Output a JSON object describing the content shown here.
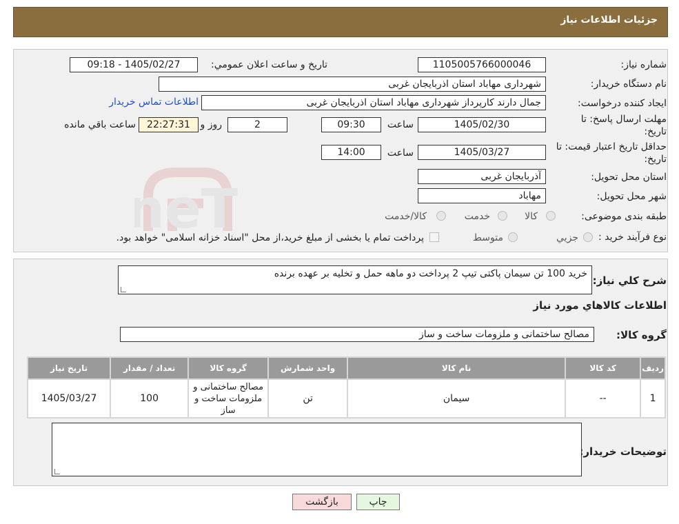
{
  "header": {
    "title": "جزئیات اطلاعات نیاز"
  },
  "form": {
    "need_number_label": "شماره نیاز:",
    "need_number": "1105005766000046",
    "announce_label": "تاريخ و ساعت اعلان عمومي:",
    "announce_value": "1405/02/27 - 09:18",
    "buyer_org_label": "نام دستگاه خريدار:",
    "buyer_org": "شهرداری مهاباد استان اذربایجان غربی",
    "creator_label": "ايجاد کننده درخواست:",
    "creator": "جمال دارند کارپرداز  شهرداری مهاباد استان اذربایجان غربی",
    "contact_link": "اطلاعات تماس خريدار",
    "deadline_label_1": "مهلت ارسال پاسخ: تا",
    "deadline_label_2": "تاريخ:",
    "deadline_date": "1405/02/30",
    "time_label": "ساعت",
    "deadline_time": "09:30",
    "days_value": "2",
    "days_label": "روز و",
    "remaining_time": "22:27:31",
    "remaining_label": "ساعت باقي مانده",
    "price_label_1": "حداقل تاريخ اعتبار قيمت: تا",
    "price_label_2": "تاريخ:",
    "price_date": "1405/03/27",
    "price_time": "14:00",
    "province_label": "استان محل تحويل:",
    "province": "آذربایجان غربی",
    "city_label": "شهر محل تحويل:",
    "city": "مهاباد",
    "category_label": "طبقه بندی موضوعی:",
    "category_options": [
      "کالا",
      "خدمت",
      "کالا/خدمت"
    ],
    "process_label": "نوع فرآيند خريد :",
    "process_options": [
      "جزيي",
      "متوسط"
    ],
    "process_note": "پرداخت تمام يا بخشی از مبلغ خريد،از محل \"اسناد خزانه اسلامی\" خواهد بود."
  },
  "summary": {
    "label": "شرح کلي نياز:",
    "text": "خرید 100 تن سیمان پاکتی تیپ 2 پرداخت دو ماهه حمل و تخلیه بر عهده برنده",
    "items_heading": "اطلاعات کالاهاي مورد نياز",
    "group_label": "گروه کالا:",
    "group_value": "مصالح ساختمانی و ملزومات ساخت و ساز"
  },
  "table": {
    "headers": [
      "رديف",
      "کد کالا",
      "نام کالا",
      "واحد شمارش",
      "گروه کالا",
      "تعداد / مقدار",
      "تاريخ نياز"
    ],
    "rows": [
      [
        "1",
        "--",
        "سیمان",
        "تن",
        "مصالح ساختمانی و ملزومات ساخت و ساز",
        "100",
        "1405/03/27"
      ]
    ]
  },
  "notes": {
    "label": "توضيحات خريدار:",
    "value": ""
  },
  "buttons": {
    "print": "چاپ",
    "back": "بازگشت"
  },
  "watermark": {
    "text": "AriaTender.neT"
  },
  "colors": {
    "header_bg": "#8a6e3e",
    "timer_bg": "#fdf7d8",
    "back_btn": "#f8dada",
    "print_btn": "#e6f7e0",
    "link": "#1a4fd1"
  }
}
